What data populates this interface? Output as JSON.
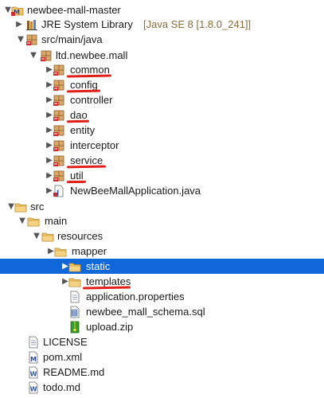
{
  "annotation_color": "#e0201a",
  "selection_color": "#1067d9",
  "tree": [
    {
      "label": "newbee-mall-master",
      "icon": "maven-project-icon",
      "arrow": "expanded"
    },
    {
      "label": "JRE System Library",
      "suffix": "[Java SE 8 [1.8.0_241]]",
      "icon": "library-icon",
      "arrow": "collapsed"
    },
    {
      "label": "src/main/java",
      "icon": "source-folder-icon",
      "arrow": "expanded"
    },
    {
      "label": "ltd.newbee.mall",
      "icon": "package-icon",
      "arrow": "expanded"
    },
    {
      "label": "common",
      "icon": "package-icon",
      "arrow": "collapsed",
      "underlined": true
    },
    {
      "label": "config",
      "icon": "package-icon",
      "arrow": "collapsed",
      "underlined": true
    },
    {
      "label": "controller",
      "icon": "package-icon",
      "arrow": "collapsed"
    },
    {
      "label": "dao",
      "icon": "package-icon",
      "arrow": "collapsed",
      "underlined": true
    },
    {
      "label": "entity",
      "icon": "package-icon",
      "arrow": "collapsed"
    },
    {
      "label": "interceptor",
      "icon": "package-icon",
      "arrow": "collapsed"
    },
    {
      "label": "service",
      "icon": "package-icon",
      "arrow": "collapsed",
      "underlined": true
    },
    {
      "label": "util",
      "icon": "package-icon",
      "arrow": "collapsed",
      "underlined": true
    },
    {
      "label": "NewBeeMallApplication.java",
      "icon": "java-file-icon",
      "arrow": "collapsed"
    },
    {
      "label": "src",
      "icon": "folder-icon",
      "arrow": "expanded"
    },
    {
      "label": "main",
      "icon": "folder-icon",
      "arrow": "expanded"
    },
    {
      "label": "resources",
      "icon": "folder-icon",
      "arrow": "expanded"
    },
    {
      "label": "mapper",
      "icon": "folder-icon",
      "arrow": "collapsed"
    },
    {
      "label": "static",
      "icon": "folder-icon",
      "arrow": "collapsed",
      "selected": true
    },
    {
      "label": "templates",
      "icon": "folder-icon",
      "arrow": "collapsed",
      "underlined": true
    },
    {
      "label": "application.properties",
      "icon": "text-file-icon",
      "arrow": "none"
    },
    {
      "label": "newbee_mall_schema.sql",
      "icon": "sql-file-icon",
      "arrow": "none"
    },
    {
      "label": "upload.zip",
      "icon": "zip-file-icon",
      "arrow": "none"
    },
    {
      "label": "LICENSE",
      "icon": "text-file-icon",
      "arrow": "none"
    },
    {
      "label": "pom.xml",
      "icon": "maven-file-icon",
      "arrow": "none"
    },
    {
      "label": "README.md",
      "icon": "word-file-icon",
      "arrow": "none"
    },
    {
      "label": "todo.md",
      "icon": "word-file-icon",
      "arrow": "none"
    }
  ]
}
